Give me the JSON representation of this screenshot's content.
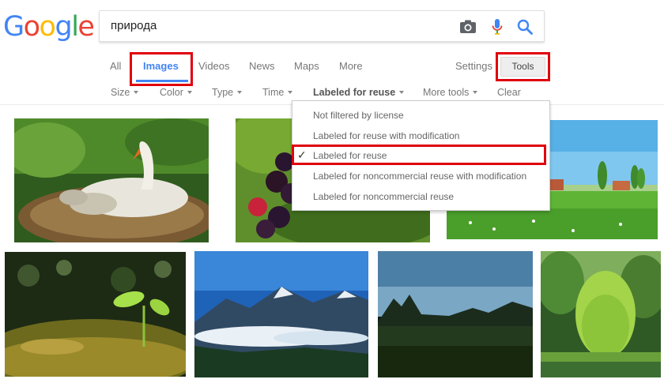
{
  "logo": {
    "letters": [
      "G",
      "o",
      "o",
      "g",
      "l",
      "e"
    ],
    "colors": [
      "#4285f4",
      "#ea4335",
      "#fbbc05",
      "#4285f4",
      "#34a853",
      "#ea4335"
    ]
  },
  "search": {
    "query": "природа",
    "icons": [
      "camera-icon",
      "microphone-icon",
      "search-icon"
    ]
  },
  "tabs": [
    {
      "label": "All"
    },
    {
      "label": "Images"
    },
    {
      "label": "Videos"
    },
    {
      "label": "News"
    },
    {
      "label": "Maps"
    },
    {
      "label": "More"
    }
  ],
  "settings_label": "Settings",
  "tools_label": "Tools",
  "filters": [
    {
      "label": "Size"
    },
    {
      "label": "Color"
    },
    {
      "label": "Type"
    },
    {
      "label": "Time"
    },
    {
      "label": "Labeled for reuse"
    },
    {
      "label": "More tools"
    },
    {
      "label": "Clear"
    }
  ],
  "dropdown": {
    "items": [
      {
        "label": "Not filtered by license",
        "checked": false
      },
      {
        "label": "Labeled for reuse with modification",
        "checked": false
      },
      {
        "label": "Labeled for reuse",
        "checked": true
      },
      {
        "label": "Labeled for noncommercial reuse with modification",
        "checked": false
      },
      {
        "label": "Labeled for noncommercial reuse",
        "checked": false
      }
    ],
    "check_glyph": "✓"
  },
  "highlight_color": "#e0000d",
  "accent_color": "#4285f4"
}
